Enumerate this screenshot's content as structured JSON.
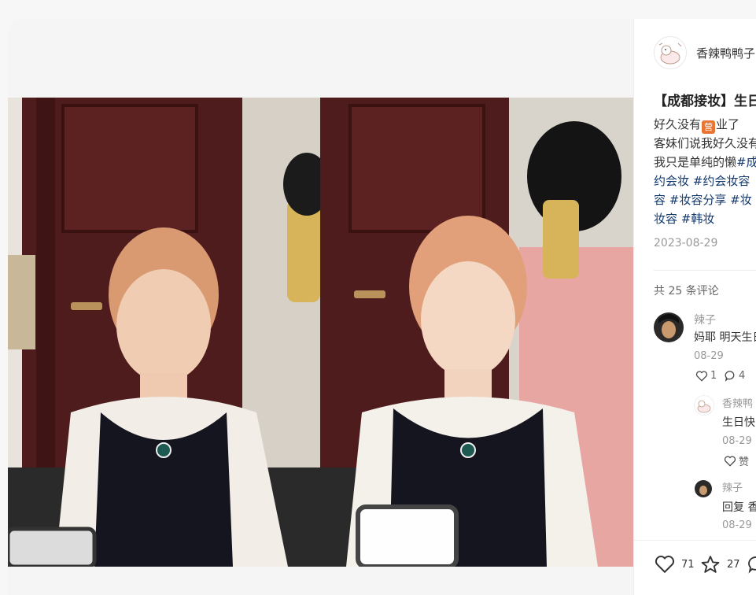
{
  "author": {
    "name": "香辣鸭鸭子",
    "avatar_icon": "cartoon-duck-avatar"
  },
  "note": {
    "title": "【成都接妆】生日",
    "desc_line1_before": "好久没有",
    "desc_line1_emoji": "营",
    "desc_line1_after": "业了",
    "desc_line2": "客妹们说我好久没有",
    "desc_line3_text": "我只是单纯的懒",
    "desc_line3_tag": "#成",
    "desc_line4_tag1": "约会妆",
    "desc_line4_tag2": "#约会妆容",
    "desc_line5_tag0": "容",
    "desc_line5_tag1": "#妆容分享",
    "desc_line5_tag2": "#妆",
    "desc_line6_tag1": "妆容",
    "desc_line6_tag2": "#韩妆",
    "date": "2023-08-29"
  },
  "comments": {
    "count_label": "共 25 条评论",
    "items": [
      {
        "name": "辣子",
        "text": "妈耶 明天生日",
        "date": "08-29",
        "likes": "1",
        "replies": "4"
      },
      {
        "name": "香辣鸭",
        "text": "生日快",
        "date": "08-29",
        "like_label": "赞"
      },
      {
        "name": "辣子",
        "text": "回复 香",
        "date": "08-29"
      }
    ]
  },
  "engagement": {
    "likes": "71",
    "collects": "27"
  },
  "colors": {
    "tag": "#13386c",
    "door": "#5a2424"
  }
}
